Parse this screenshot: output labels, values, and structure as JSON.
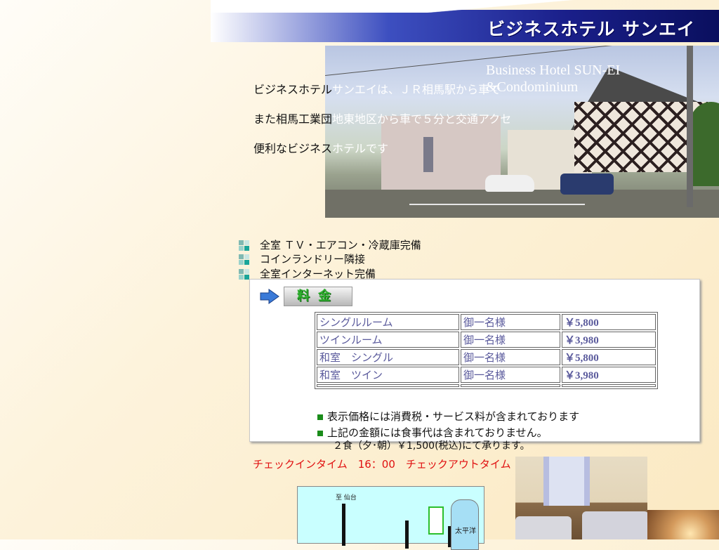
{
  "header": {
    "title": "ビジネスホテル サンエイ"
  },
  "hero": {
    "caption": "Business Hotel SUN-EI &Condominium"
  },
  "intro": {
    "line1_a": "ビジネスホテル",
    "line1_b": "サンエイは、ＪＲ相馬駅から車で",
    "line2_a": "また相馬工業団",
    "line2_b": "地東地区から車で５分と交通アクセ",
    "line3_a": "便利なビジネス",
    "line3_b": "ホテルです"
  },
  "features": [
    "全室 ＴＶ・エアコン・冷蔵庫完備",
    "コインランドリー隣接",
    "全室インターネット完備"
  ],
  "rates": {
    "heading": "料金",
    "rows": [
      {
        "room": "シングルルーム",
        "guests": "御一名様",
        "price": "￥5,800"
      },
      {
        "room": "ツインルーム",
        "guests": "御一名様",
        "price": "￥3,980"
      },
      {
        "room": "和室　シングル",
        "guests": "御一名様",
        "price": "￥5,800"
      },
      {
        "room": "和室　ツイン",
        "guests": "御一名様",
        "price": "￥3,980"
      }
    ],
    "notes": [
      "表示価格には消費税・サービス料が含まれております",
      "上記の金額には食事代は含まれておりません。"
    ],
    "meal": "２食（夕･朝）￥1,500(税込)にて承ります。"
  },
  "checkin": "チェックインタイム　16：00　チェックアウトタイム",
  "map": {
    "label": "至 仙台",
    "sea_label": "太平洋"
  },
  "colors": {
    "header_blue": "#1a1f8a",
    "checkin_red": "#e01010",
    "rate_text": "#5a5a9c",
    "bullet_green": "#1a8c1a"
  }
}
